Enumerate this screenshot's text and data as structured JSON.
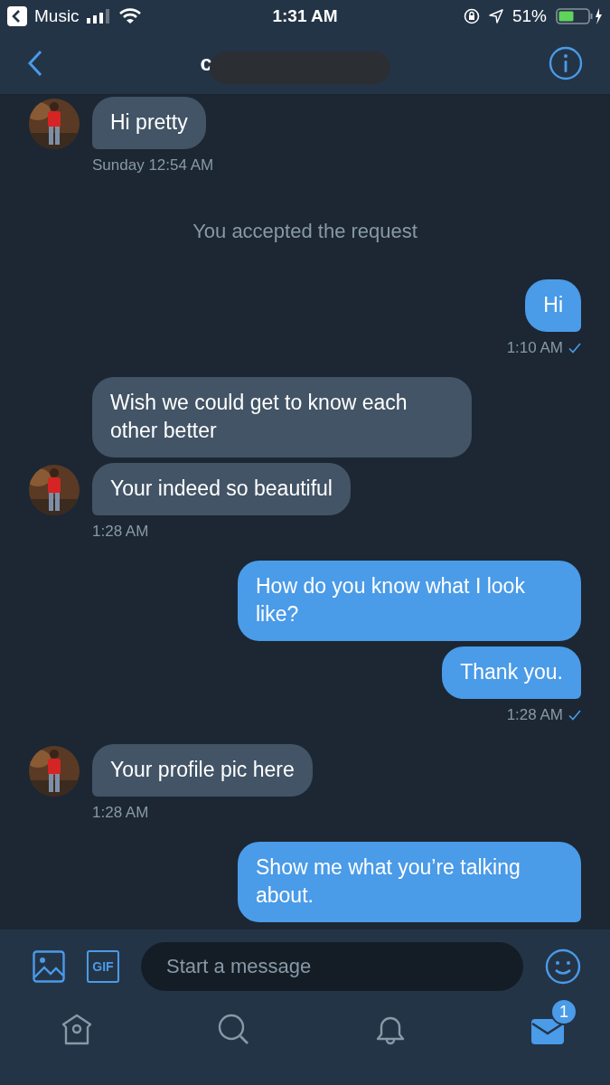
{
  "status_bar": {
    "back_app": "Music",
    "time": "1:31 AM",
    "battery": "51%"
  },
  "header": {
    "name": "c"
  },
  "messages": [
    {
      "kind": "received",
      "bubbles": [
        "Hi pretty"
      ],
      "time": "Sunday 12:54 AM"
    },
    {
      "kind": "system",
      "text": "You accepted the request"
    },
    {
      "kind": "sent",
      "bubbles": [
        "Hi"
      ],
      "time": "1:10 AM",
      "read": true
    },
    {
      "kind": "received",
      "bubbles": [
        "Wish we could get to know each other better",
        "Your indeed so beautiful"
      ],
      "time": "1:28 AM"
    },
    {
      "kind": "sent",
      "bubbles": [
        "How do you know what I look like?",
        "Thank you."
      ],
      "time": "1:28 AM",
      "read": true
    },
    {
      "kind": "received",
      "bubbles": [
        "Your profile pic here"
      ],
      "time": "1:28 AM"
    },
    {
      "kind": "sent",
      "bubbles": [
        "Show me what you’re talking about."
      ]
    }
  ],
  "composer": {
    "gif_label": "GIF",
    "placeholder": "Start a message"
  },
  "tabs": [
    {
      "kind": "home",
      "selected": false
    },
    {
      "kind": "search",
      "selected": false
    },
    {
      "kind": "notifications",
      "selected": false
    },
    {
      "kind": "messages",
      "selected": true,
      "badge": "1"
    }
  ]
}
